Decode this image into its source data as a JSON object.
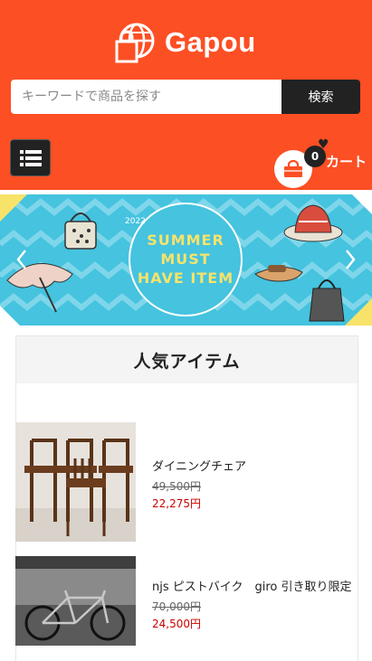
{
  "header": {
    "brand": "Gapou",
    "search_placeholder": "キーワードで商品を探す",
    "search_button": "検索",
    "cart_count": "0",
    "cart_label": "カート",
    "bg_color": "#fc4f24"
  },
  "banner": {
    "year": "2022",
    "line1": "SUMMER",
    "line2": "MUST",
    "line3": "HAVE ITEM"
  },
  "section": {
    "title": "人気アイテム"
  },
  "items": [
    {
      "name": "ダイニングチェア",
      "old_price": "49,500円",
      "new_price": "22,275円"
    },
    {
      "name": "njs ピストバイク　giro 引き取り限定",
      "old_price": "70,000円",
      "new_price": "24,500円"
    }
  ],
  "icons": [
    "shopping-bag-globe-icon",
    "list-menu-icon",
    "cart-bag-icon",
    "heart-icon",
    "chevron-left-icon",
    "chevron-right-icon"
  ]
}
